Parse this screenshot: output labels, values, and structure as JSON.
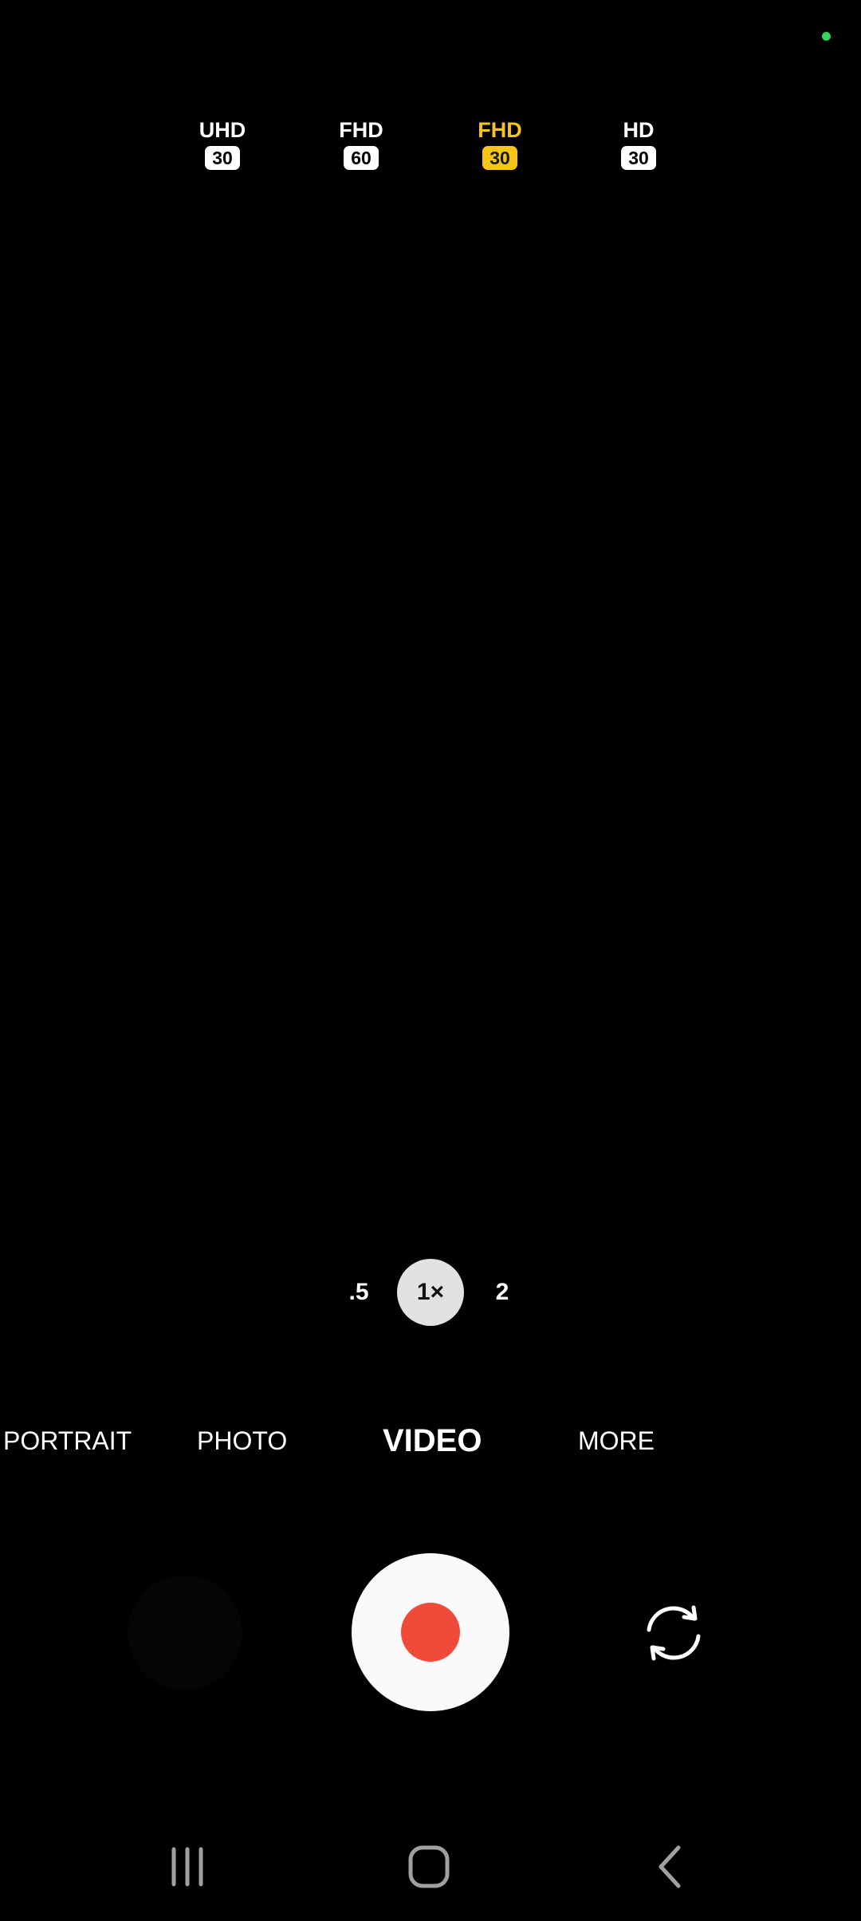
{
  "colors": {
    "background": "#000000",
    "accent": "#f5c518",
    "record": "#f04a3a",
    "status_dot": "#2fd65a",
    "nav_icon": "#a0a0a0"
  },
  "resolution_options": [
    {
      "label": "UHD",
      "fps": "30",
      "selected": false
    },
    {
      "label": "FHD",
      "fps": "60",
      "selected": false
    },
    {
      "label": "FHD",
      "fps": "30",
      "selected": true
    },
    {
      "label": "HD",
      "fps": "30",
      "selected": false
    }
  ],
  "zoom": {
    "options": [
      ".5",
      "1×",
      "2"
    ],
    "selected": "1×"
  },
  "modes": {
    "items": [
      "PORTRAIT",
      "PHOTO",
      "VIDEO",
      "MORE"
    ],
    "selected": "VIDEO"
  },
  "controls": {
    "record_icon": "record-icon",
    "flip_icon": "switch-camera-icon"
  },
  "navigation": {
    "recents_icon": "recents-icon",
    "home_icon": "home-icon",
    "back_icon": "back-icon"
  }
}
